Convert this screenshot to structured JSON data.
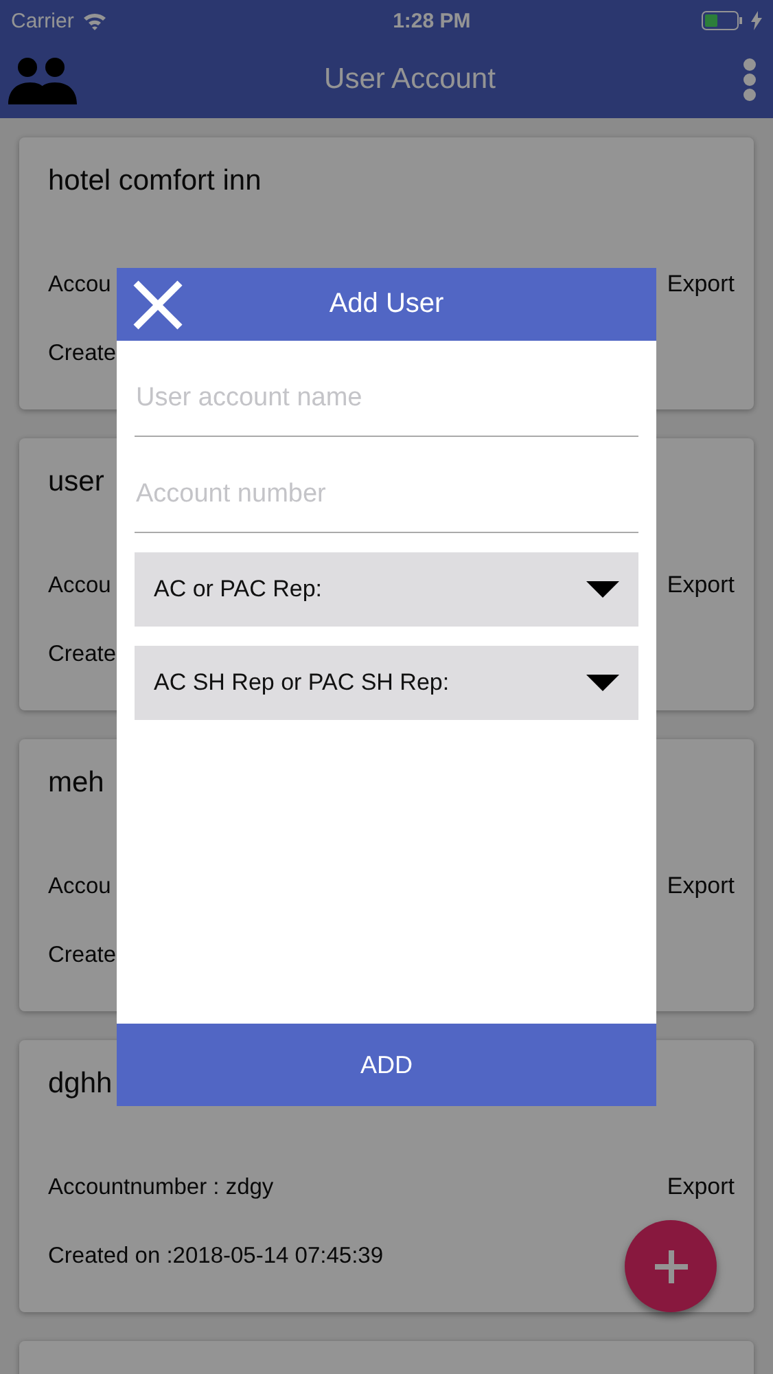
{
  "status_bar": {
    "carrier": "Carrier",
    "time": "1:28 PM"
  },
  "app_bar": {
    "title": "User Account"
  },
  "cards": [
    {
      "title": "hotel comfort inn",
      "account": "Accou",
      "created": "Create",
      "action": "Export"
    },
    {
      "title": "user",
      "account": "Accou",
      "created": "Create",
      "action": "Export"
    },
    {
      "title": "meh",
      "account": "Accou",
      "created": "Create",
      "action": "Export"
    },
    {
      "title": "dghh",
      "account": "Accountnumber :  zdgy",
      "created": "Created on :2018-05-14 07:45:39",
      "action": "Export"
    }
  ],
  "dialog": {
    "title": "Add User",
    "fields": [
      {
        "placeholder": "User account name"
      },
      {
        "placeholder": "Account number"
      }
    ],
    "dropdowns": [
      {
        "label": "AC or PAC Rep:"
      },
      {
        "label": "AC SH Rep or PAC SH Rep:"
      }
    ],
    "submit": "ADD"
  }
}
